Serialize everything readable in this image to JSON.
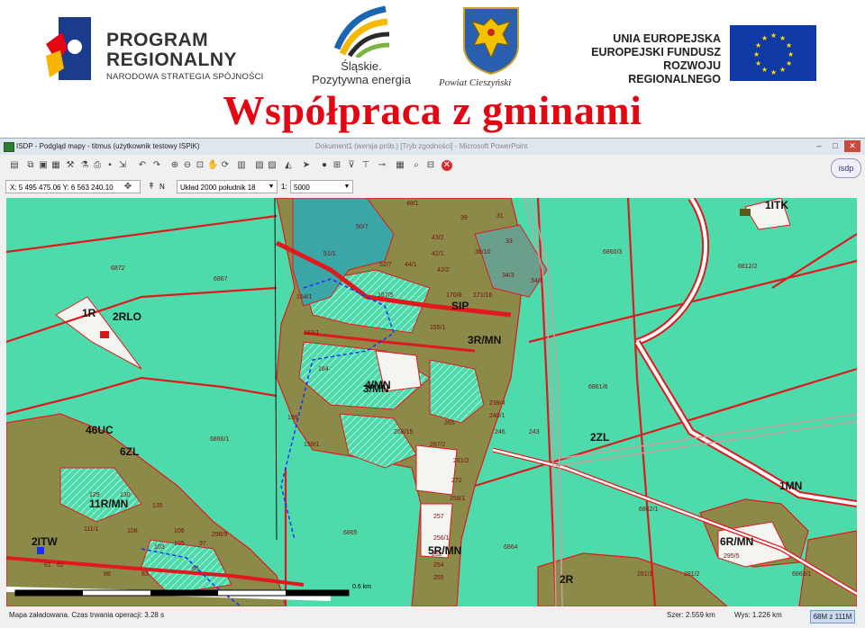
{
  "header": {
    "program_line1": "PROGRAM",
    "program_line2": "REGIONALNY",
    "program_line3": "NARODOWA STRATEGIA SPÓJNOŚCI",
    "slaskie_line1": "Śląskie.",
    "slaskie_line2": "Pozytywna energia",
    "powiat": "Powiat Cieszyński",
    "ue_line1": "UNIA EUROPEJSKA",
    "ue_line2": "EUROPEJSKI FUNDUSZ",
    "ue_line3": "ROZWOJU REGIONALNEGO",
    "slide_title": "Współpraca z gminami"
  },
  "window": {
    "title": "ISDP - Podgląd mapy - titmus (użytkownik testowy ISPiK)",
    "background_title": "Dokument1 (wersja prób.) [Tryb zgodności] - Microsoft PowerPoint",
    "buttons": {
      "minimize": "–",
      "maximize": "□",
      "close": "✕"
    },
    "logo": "isdp"
  },
  "toolbar": {
    "coords": "X: 5 495 475.06  Y: 6 563 240.10",
    "north": "N",
    "crs": "Układ 2000 południk 18",
    "scale_prefix": "1:",
    "scale": "5000"
  },
  "status": {
    "message": "Mapa załadowana. Czas trwania operacji: 3.28 s",
    "width": "Szer: 2.559 km",
    "height": "Wys: 1.226 km",
    "memory": "68M z 111M"
  },
  "map": {
    "zone_labels": [
      "1ITK",
      "2RLO",
      "1R",
      "3R/MN",
      "1MN",
      "2ZL",
      "6R/MN",
      "46UC",
      "6ZL",
      "11R/MN",
      "2ITW",
      "5R/MN",
      "2R",
      "3/MN",
      "SIP",
      "4/MN"
    ],
    "parcel_labels": [
      "6872",
      "6867",
      "6860/3",
      "6812/2",
      "6861/6",
      "6866/1",
      "6862/1",
      "6865",
      "6864",
      "6863/1",
      "295/5",
      "51/1",
      "50/7",
      "48/1",
      "39",
      "31",
      "42/1",
      "43/2",
      "33",
      "42/2",
      "44/1",
      "52/7",
      "38/10",
      "34/3",
      "34/1",
      "164/1",
      "167/5",
      "170/8",
      "171/16",
      "155/1",
      "163/1",
      "164",
      "267/2",
      "239/4",
      "240/1",
      "243",
      "246",
      "252",
      "254",
      "255",
      "256/1",
      "257",
      "258/1",
      "261/2",
      "265",
      "268/15",
      "272",
      "199",
      "159/1",
      "129",
      "130",
      "135",
      "103",
      "106",
      "108",
      "111/1",
      "105",
      "97",
      "61",
      "62",
      "88",
      "83",
      "63",
      "281/1",
      "281/2",
      "298/9"
    ],
    "scale_label": "0.6 km",
    "colors": {
      "base": "#4ddbab",
      "boundary": "#e0191e",
      "fill": "#8b8a48",
      "road": "#ffffff",
      "marker": "#1a30ff"
    }
  }
}
